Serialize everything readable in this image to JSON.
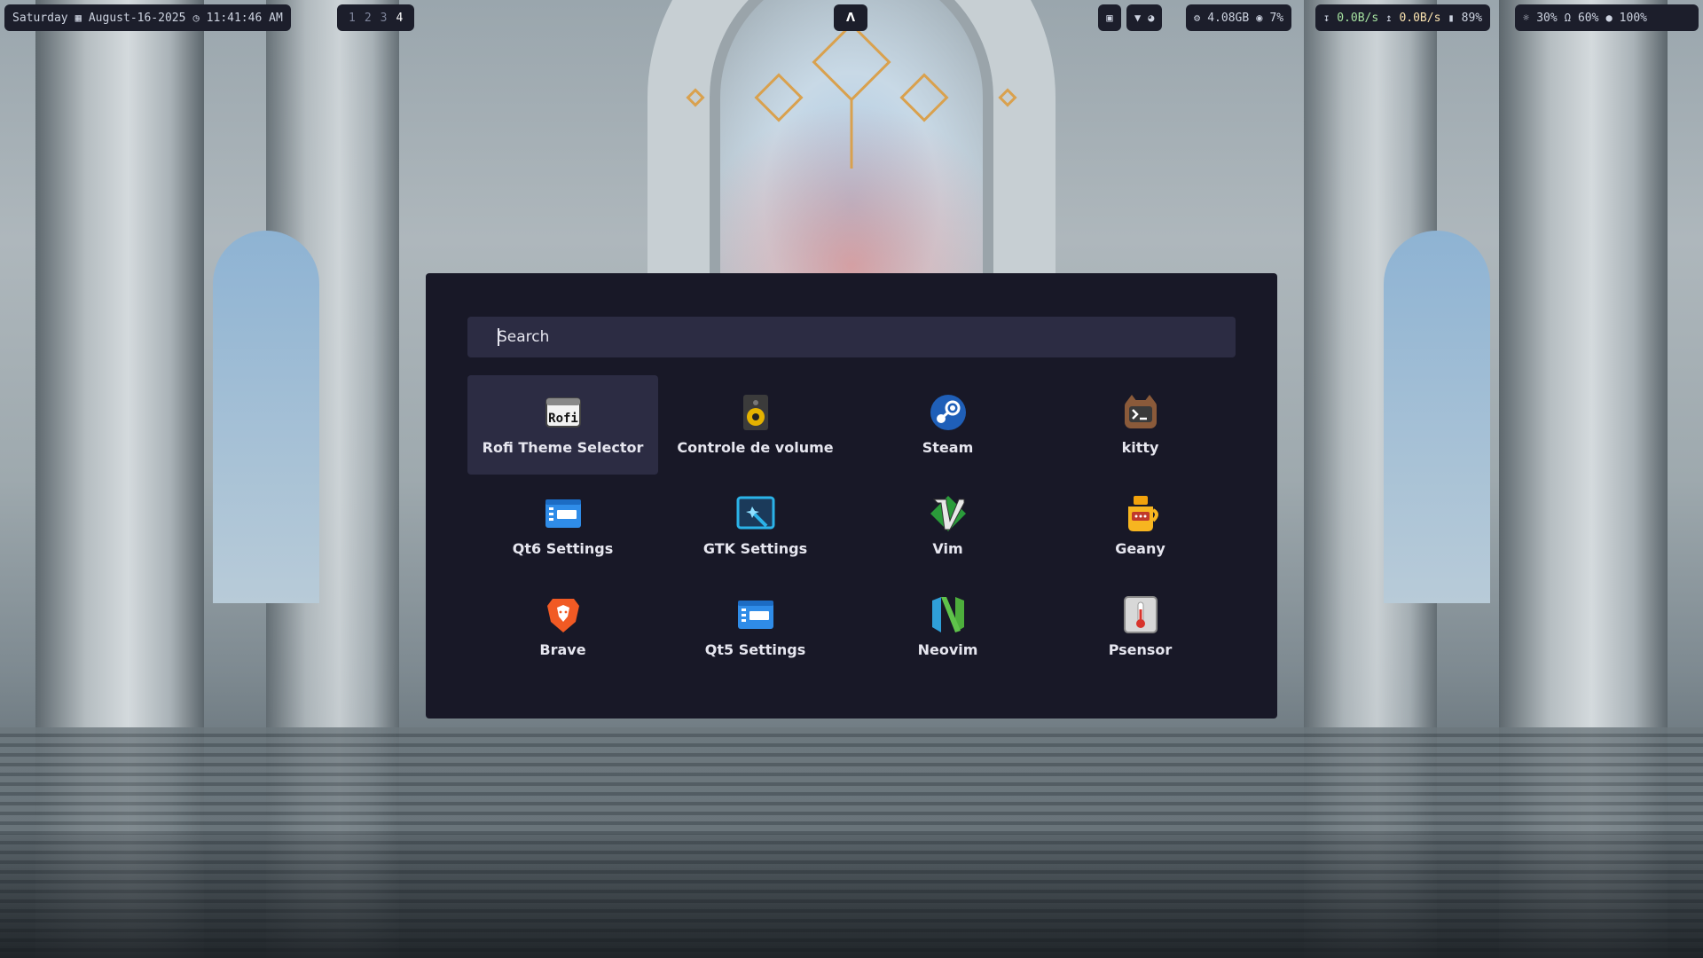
{
  "topbar": {
    "day": "Saturday",
    "date": "August-16-2025",
    "time": "11:41:46 AM",
    "workspaces": [
      "1",
      "2",
      "3",
      "4"
    ],
    "active_workspace": "4",
    "memory": "4.08GB",
    "cpu": "7%",
    "net_down": "0.0B/s",
    "net_up": "0.0B/s",
    "battery": "89%",
    "brightness": "30%",
    "volume": "60%",
    "mic": "100%"
  },
  "launcher": {
    "search_placeholder": "Search",
    "selected": "Rofi Theme Selector",
    "apps": [
      {
        "label": "Rofi Theme Selector",
        "icon": "rofi-icon"
      },
      {
        "label": "Controle de volume",
        "icon": "speaker-icon"
      },
      {
        "label": "Steam",
        "icon": "steam-icon"
      },
      {
        "label": "kitty",
        "icon": "kitty-icon"
      },
      {
        "label": "Qt6 Settings",
        "icon": "qt-settings-icon"
      },
      {
        "label": "GTK Settings",
        "icon": "gtk-settings-icon"
      },
      {
        "label": "Vim",
        "icon": "vim-icon"
      },
      {
        "label": "Geany",
        "icon": "geany-icon"
      },
      {
        "label": "Brave",
        "icon": "brave-icon"
      },
      {
        "label": "Qt5 Settings",
        "icon": "qt-settings-icon"
      },
      {
        "label": "Neovim",
        "icon": "neovim-icon"
      },
      {
        "label": "Psensor",
        "icon": "thermometer-icon"
      }
    ]
  },
  "colors": {
    "bar_bg": "#1c1e2b",
    "launcher_bg": "#181827",
    "highlight_bg": "#2c2c43",
    "text": "#e6e6ef",
    "net_green": "#a6e3a1",
    "net_yellow": "#f9e2af"
  }
}
